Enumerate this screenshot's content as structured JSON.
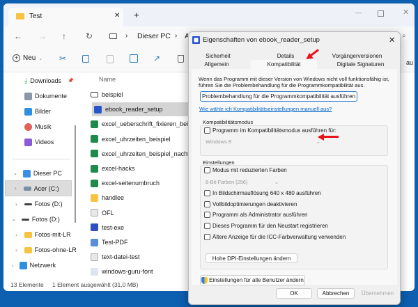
{
  "explorer": {
    "tab_title": "Test",
    "new_tab": "+",
    "breadcrumb": [
      "Dieser PC",
      "A"
    ],
    "toolbar": {
      "new_label": "Neu"
    },
    "nav": [
      {
        "label": "Downloads",
        "icon": "download-icon"
      },
      {
        "label": "Dokumente",
        "icon": "document-icon"
      },
      {
        "label": "Bilder",
        "icon": "pictures-icon"
      },
      {
        "label": "Musik",
        "icon": "music-icon"
      },
      {
        "label": "Videos",
        "icon": "videos-icon"
      },
      {
        "label": "Dieser PC",
        "icon": "pc-icon"
      },
      {
        "label": "Acer (C:)",
        "icon": "drive-icon"
      },
      {
        "label": "Fotos (D:)",
        "icon": "drive-icon"
      },
      {
        "label": "Fotos (D:)",
        "icon": "drive-icon"
      },
      {
        "label": "Fotos-mit-LR",
        "icon": "folder-icon"
      },
      {
        "label": "Fotos-ohne-LR",
        "icon": "folder-icon"
      },
      {
        "label": "Netzwerk",
        "icon": "network-icon"
      }
    ],
    "column_name": "Name",
    "files": [
      {
        "name": "beispiel",
        "icon": "mail-icon"
      },
      {
        "name": "ebook_reader_setup",
        "icon": "app-icon",
        "selected": true
      },
      {
        "name": "excel_ueberschrift_fixieren_beispiel",
        "icon": "excel-icon"
      },
      {
        "name": "excel_uhrzeiten_beispiel",
        "icon": "excel-icon"
      },
      {
        "name": "excel_uhrzeiten_beispiel_nachtschicht",
        "icon": "excel-icon"
      },
      {
        "name": "excel-hacks",
        "icon": "excel-icon"
      },
      {
        "name": "excel-seitenumbruch",
        "icon": "excel-icon"
      },
      {
        "name": "handlee",
        "icon": "folder-icon"
      },
      {
        "name": "OFL",
        "icon": "text-file-icon"
      },
      {
        "name": "test-exe",
        "icon": "save-icon"
      },
      {
        "name": "Test-PDF",
        "icon": "pdf-icon"
      },
      {
        "name": "text-datei-test",
        "icon": "text-file-icon"
      },
      {
        "name": "windows-guru-font",
        "icon": "font-icon"
      }
    ],
    "partial_right": "au",
    "status": {
      "count": "13 Elemente",
      "selection": "1 Element ausgewählt (31,0 MB)"
    }
  },
  "dialog": {
    "title": "Eigenschaften von ebook_reader_setup",
    "tabs_row1": [
      "Sicherheit",
      "Details",
      "Vorgängerversionen"
    ],
    "tabs_row2": [
      "Allgemein",
      "Kompatibilität",
      "Digitale Signaturen"
    ],
    "active_tab": "Kompatibilität",
    "intro": "Wenn das Programm mit dieser Version von Windows nicht voll funktionsfähig ist, führen Sie die Problembehandlung für die Programmkompatibilität aus.",
    "troubleshoot_button": "Problembehandlung für die Programmkompatibilität ausführen",
    "help_link": "Wie wähle ich Kompatibilitätseinstellungen manuell aus?",
    "compat_group": "Kompatibilitätsmodus",
    "compat_checkbox": "Programm im Kompatibilitätsmodus ausführen für:",
    "compat_select": "Windows 8",
    "settings_group": "Einstellungen",
    "reduced_color": "Modus mit reduzierten Farben",
    "color_select": "8-Bit-Farben (256)",
    "settings": [
      "In Bildschirmauflösung 640 x 480 ausführen",
      "Vollbildoptimierungen deaktivieren",
      "Programm als Administrator ausführen",
      "Dieses Programm für den Neustart registrieren",
      "Ältere Anzeige für die ICC-Farbverwaltung verwenden"
    ],
    "dpi_button": "Hohe DPI-Einstellungen ändern",
    "all_users_button": "Einstellungen für alle Benutzer ändern",
    "ok": "OK",
    "cancel": "Abbrechen",
    "apply": "Übernehmen"
  },
  "colors": {
    "desktop": "#0d5fb0",
    "arrow": "#e8141a",
    "link": "#0066cc"
  }
}
